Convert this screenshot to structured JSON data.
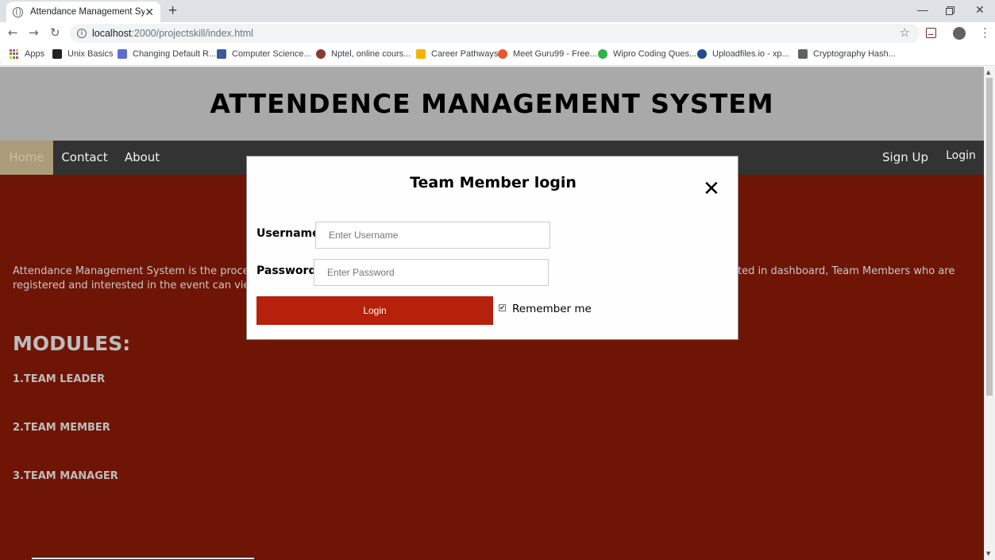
{
  "browser": {
    "tab_title": "Attendance Management System",
    "url_host": "localhost",
    "url_path": ":2000/projectskill/index.html",
    "bookmarks": [
      {
        "label": "Apps",
        "icon": "apps-grid-icon",
        "color": "#4285f4"
      },
      {
        "label": "Unix Basics",
        "icon": "terminal-icon",
        "color": "#202124"
      },
      {
        "label": "Changing Default R...",
        "icon": "flask-icon",
        "color": "#5f6ccf"
      },
      {
        "label": "Computer Science...",
        "icon": "link-icon",
        "color": "#3b5a9a"
      },
      {
        "label": "Nptel, online cours...",
        "icon": "nptel-icon",
        "color": "#8b3a2f"
      },
      {
        "label": "Career Pathways",
        "icon": "career-icon",
        "color": "#f4b400"
      },
      {
        "label": "Meet Guru99 - Free...",
        "icon": "guru99-icon",
        "color": "#e8572b"
      },
      {
        "label": "Wipro Coding Ques...",
        "icon": "wipro-icon",
        "color": "#2db34a"
      },
      {
        "label": "Uploadfiles.io - xp...",
        "icon": "upload-icon",
        "color": "#1f4e8a"
      },
      {
        "label": "Cryptography Hash...",
        "icon": "crypto-icon",
        "color": "#5f6368"
      }
    ]
  },
  "site": {
    "title": "ATTENDENCE MANAGEMENT SYSTEM",
    "nav": {
      "home": "Home",
      "contact": "Contact",
      "about": "About",
      "signup": "Sign Up",
      "login": "Login"
    },
    "intro_left": "Attendance Management System is the process",
    "intro_right": "ted in dashboard, Team Members who are",
    "intro_line2": "registered and interested in the event can view",
    "modules_heading": "MODULES:",
    "modules": [
      "1.TEAM LEADER",
      "2.TEAM MEMBER",
      "3.TEAM MANAGER"
    ]
  },
  "modal": {
    "title": "Team Member login",
    "close_glyph": "✕",
    "username_label": "Username",
    "username_placeholder": "Enter Username",
    "password_label": "Password",
    "password_placeholder": "Enter Password",
    "login_button": "Login",
    "remember_label": "Remember me",
    "remember_checked": true
  },
  "colors": {
    "page_bg": "#6f1505",
    "header_bg": "#a9a9a9",
    "nav_bg": "#333333",
    "active_nav": "#aa9c79",
    "login_button": "#b5210a"
  }
}
